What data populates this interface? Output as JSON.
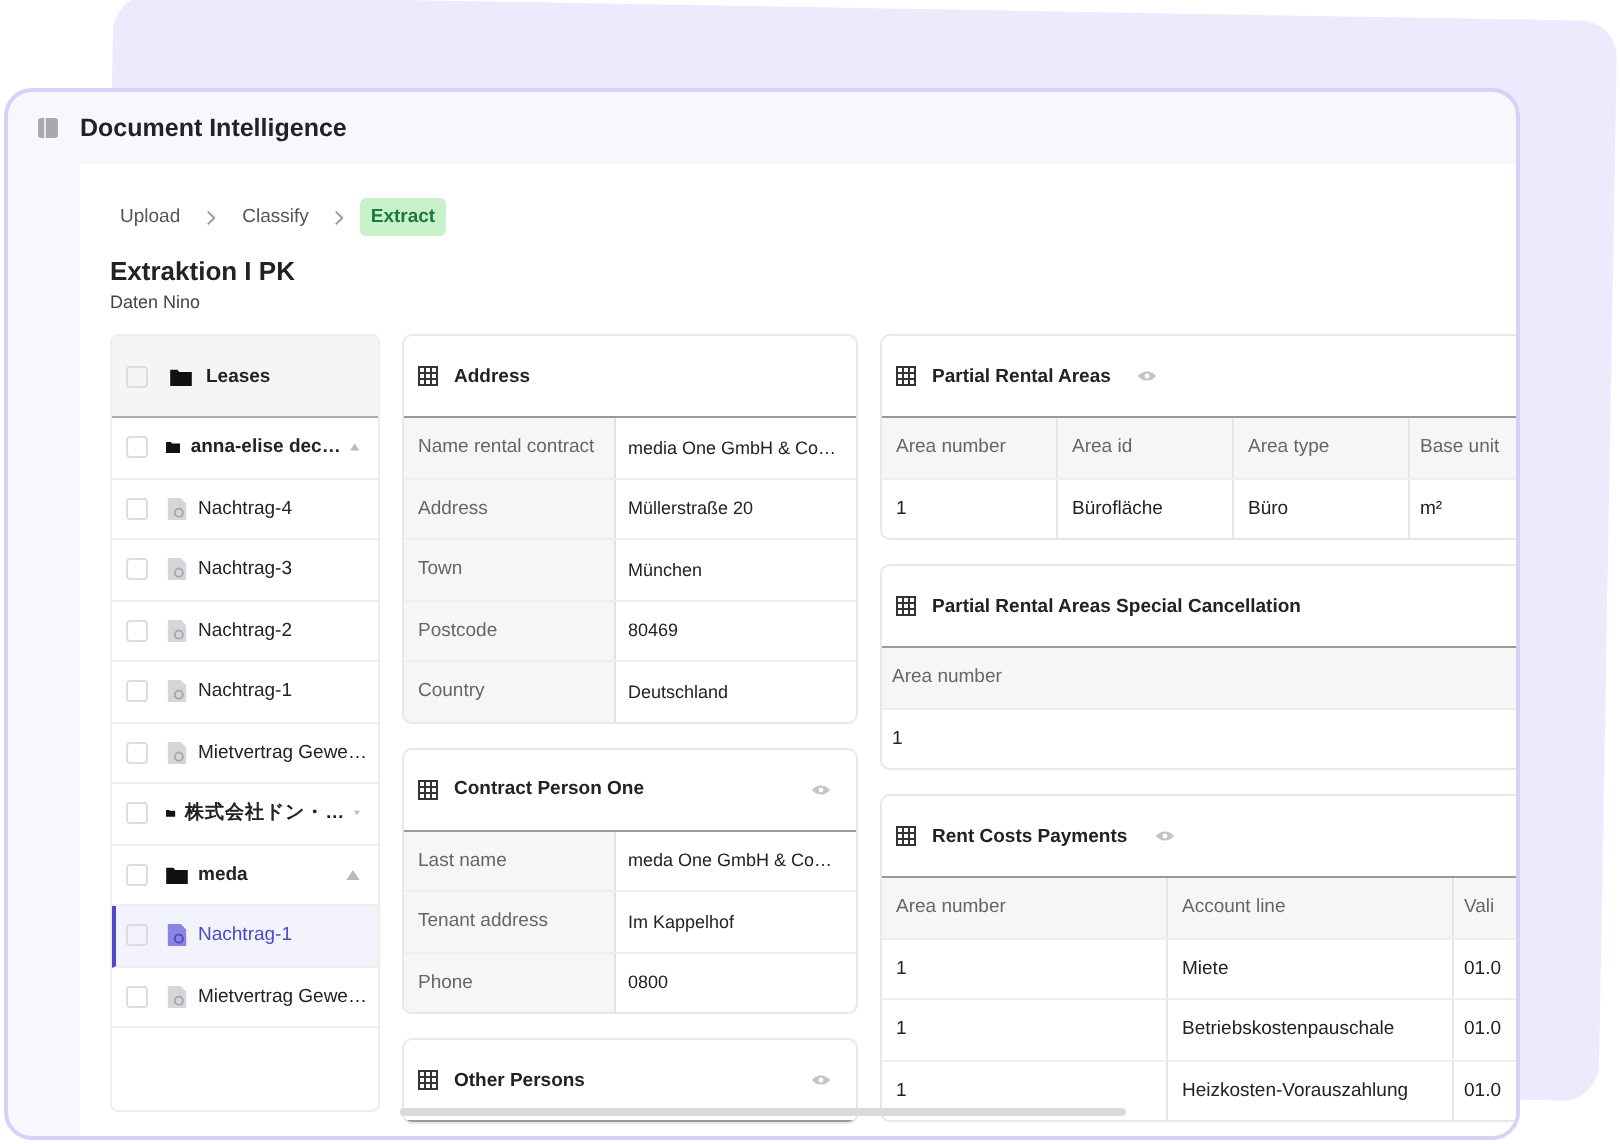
{
  "window": {
    "title": "Document Intelligence"
  },
  "breadcrumb": [
    {
      "label": "Upload",
      "selected": false
    },
    {
      "label": "Classify",
      "selected": false
    },
    {
      "label": "Extract",
      "selected": true
    }
  ],
  "heading": {
    "title": "Extraktion I PK",
    "subtitle": "Daten Nino"
  },
  "tree": {
    "label": "Leases",
    "checked": false,
    "items": [
      {
        "kind": "folder",
        "label": "anna-elise dec…",
        "checked": false,
        "selected": false,
        "expanded": true,
        "children": [
          {
            "kind": "file",
            "label": "Nachtrag-4",
            "checked": false,
            "selected": false
          },
          {
            "kind": "file",
            "label": "Nachtrag-3",
            "checked": false,
            "selected": false
          },
          {
            "kind": "file",
            "label": "Nachtrag-2",
            "checked": false,
            "selected": false
          },
          {
            "kind": "file",
            "label": "Nachtrag-1",
            "checked": false,
            "selected": false
          },
          {
            "kind": "file",
            "label": "Mietvertrag Gewe…",
            "checked": false,
            "selected": false
          }
        ]
      },
      {
        "kind": "folder",
        "label": "株式会社ドン・…",
        "checked": false,
        "selected": false,
        "expanded": false
      },
      {
        "kind": "folder",
        "label": "meda",
        "checked": false,
        "selected": false,
        "expanded": true,
        "children": [
          {
            "kind": "file",
            "label": "Nachtrag-1",
            "checked": false,
            "selected": true
          },
          {
            "kind": "file",
            "label": "Mietvertrag Gewe…",
            "checked": false,
            "selected": false
          }
        ]
      }
    ]
  },
  "field_cards": [
    {
      "title": "Address",
      "eye": false,
      "rows": [
        [
          "Name rental contract",
          "media One GmbH & Co…"
        ],
        [
          "Address",
          "Müllerstraße 20"
        ],
        [
          "Town",
          "München"
        ],
        [
          "Postcode",
          "80469"
        ],
        [
          "Country",
          "Deutschland"
        ]
      ]
    },
    {
      "title": "Contract Person One",
      "eye": true,
      "rows": [
        [
          "Last name",
          "meda One GmbH & Co…"
        ],
        [
          "Tenant address",
          "Im Kappelhof"
        ],
        [
          "Phone",
          "0800"
        ]
      ]
    },
    {
      "title": "Other Persons",
      "eye": true
    }
  ],
  "table_cards": [
    {
      "title": "Partial Rental Areas",
      "eye": true,
      "columns": [
        "Area number",
        "Area id",
        "Area type",
        "Base unit"
      ],
      "rows": [
        [
          "1",
          "Bürofläche",
          "Büro",
          "m²"
        ]
      ]
    },
    {
      "title": "Partial Rental Areas Special Cancellation",
      "eye": false,
      "columns": [
        "Area number"
      ],
      "rows": [
        [
          "1"
        ]
      ]
    },
    {
      "title": "Rent Costs Payments",
      "eye": true,
      "columns": [
        "Area number",
        "Account line",
        "Vali"
      ],
      "rows": [
        [
          "1",
          "Miete",
          "01.0"
        ],
        [
          "1",
          "Betriebskostenpauschale",
          "01.0"
        ],
        [
          "1",
          "Heizkosten-Vorauszahlung",
          "01.0"
        ]
      ]
    }
  ]
}
